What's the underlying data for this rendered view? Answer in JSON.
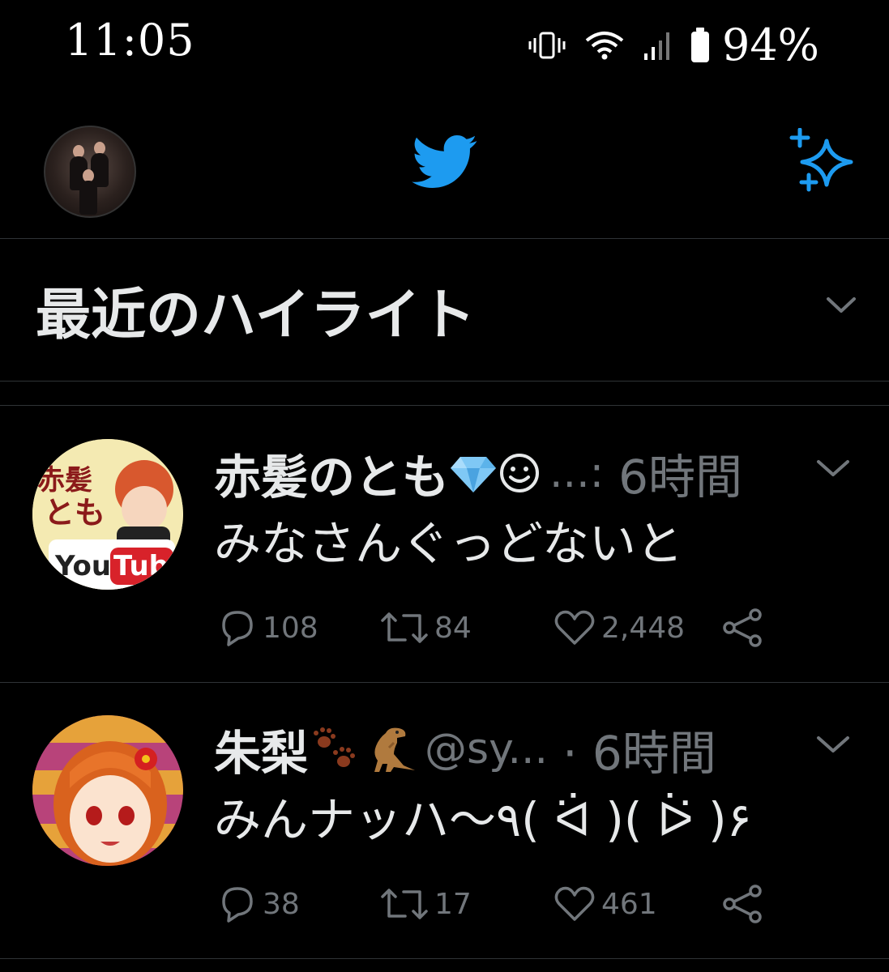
{
  "status_bar": {
    "time": "11:05",
    "battery_percent": "94%",
    "icons": [
      "vibrate-icon",
      "wifi-icon",
      "signal-icon",
      "battery-icon"
    ]
  },
  "app_bar": {
    "profile_avatar": "profile-avatar",
    "logo": "twitter-bird-icon",
    "top_tweets_icon": "sparkle-icon",
    "accent_color": "#1d9bf0"
  },
  "section": {
    "title": "最近のハイライト",
    "chevron": "chevron-down-icon"
  },
  "tweets": [
    {
      "name": "赤髪のとも",
      "name_emoji": [
        "gem-emoji",
        "smiley-emoji"
      ],
      "handle": "...:",
      "time": "6時間",
      "text": "みなさんぐっどないと",
      "replies": "108",
      "retweets": "84",
      "likes": "2,448"
    },
    {
      "name": "朱梨",
      "name_emoji": [
        "paw-prints-emoji",
        "t-rex-emoji"
      ],
      "handle": "@sy...",
      "time": "· 6時間",
      "text": "みんナッハ〜٩( ᐛ )( ᐖ )۶",
      "replies": "38",
      "retweets": "17",
      "likes": "461"
    }
  ],
  "colors": {
    "background": "#000000",
    "text_primary": "#e7e9ea",
    "text_secondary": "#71767b",
    "divider": "#2f3336"
  }
}
